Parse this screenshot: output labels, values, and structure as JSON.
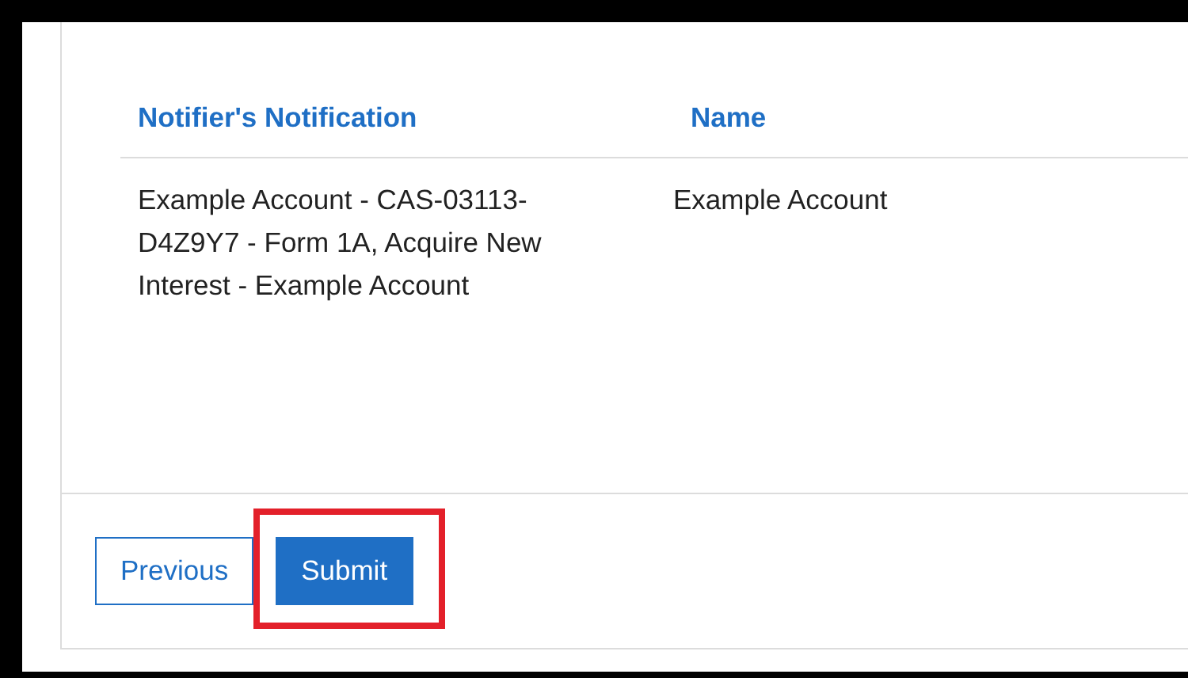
{
  "table": {
    "columns": [
      "Notifier's Notification",
      "Name"
    ],
    "rows": [
      [
        "Example Account - CAS-03113-D4Z9Y7 - Form 1A, Acquire New Interest - Example Account",
        "Example Account"
      ]
    ]
  },
  "buttons": [
    {
      "label": "Previous",
      "kind": "secondary",
      "highlighted": false
    },
    {
      "label": "Submit",
      "kind": "primary",
      "highlighted": true
    }
  ]
}
